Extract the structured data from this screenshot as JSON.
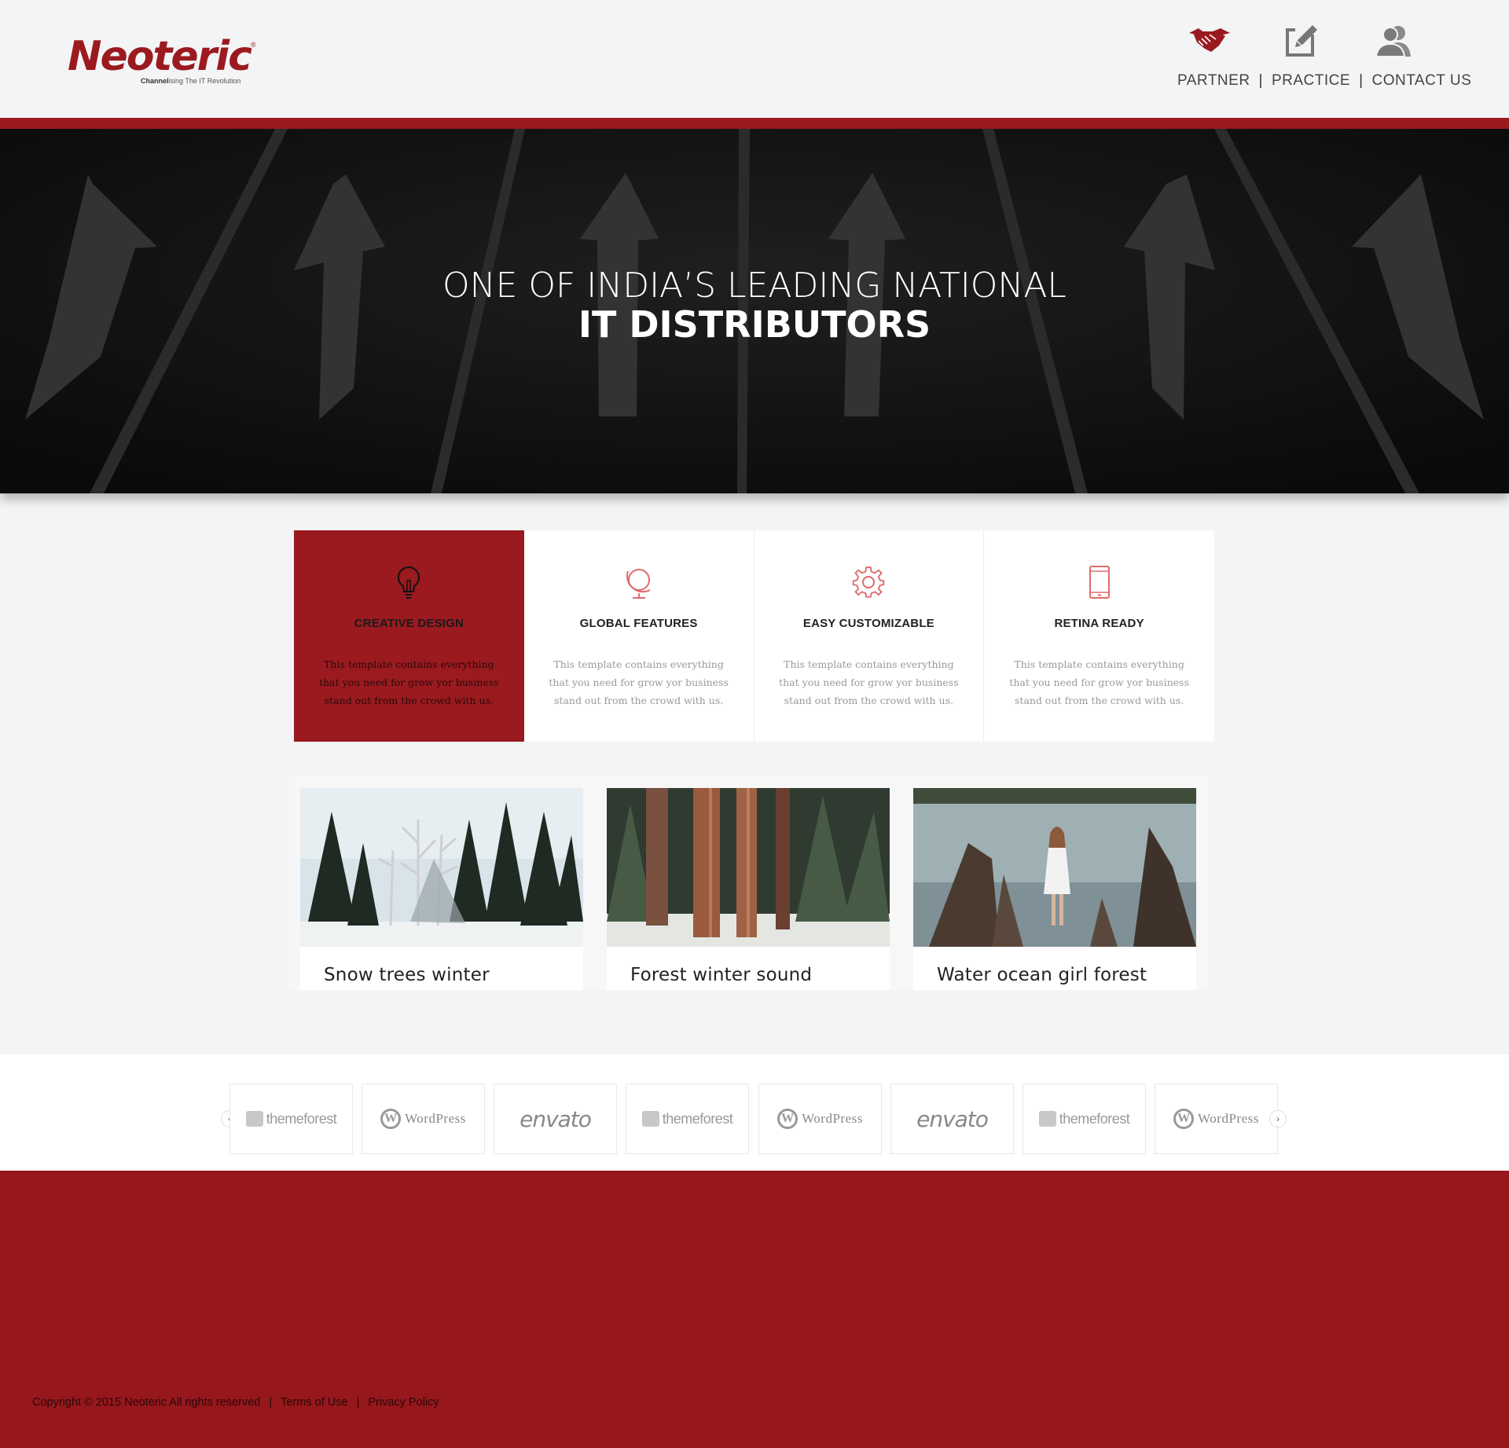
{
  "brand": {
    "name": "Neoteric",
    "registered_mark": "®",
    "tagline_bold": "Channel",
    "tagline_rest": "ising The IT Revolution",
    "color": "#9a1a1f"
  },
  "nav": {
    "icons": [
      "handshake-icon",
      "edit-icon",
      "user-group-icon"
    ],
    "items": [
      {
        "label": "PARTNER"
      },
      {
        "label": "PRACTICE"
      },
      {
        "label": "CONTACT US"
      }
    ],
    "separator": "|"
  },
  "hero": {
    "line1": "ONE OF INDIA’S LEADING NATIONAL",
    "line2": "IT DISTRIBUTORS"
  },
  "features": [
    {
      "icon": "lightbulb-icon",
      "title": "CREATIVE DESIGN",
      "desc": "This template contains everything that you need for grow yor business stand out from the crowd with us.",
      "active": true
    },
    {
      "icon": "globe-icon",
      "title": "GLOBAL FEATURES",
      "desc": "This template contains everything that you need for grow yor business stand out from the crowd with us.",
      "active": false
    },
    {
      "icon": "gear-icon",
      "title": "EASY CUSTOMIZABLE",
      "desc": "This template contains everything that you need for grow yor business stand out from the crowd with us.",
      "active": false
    },
    {
      "icon": "mobile-icon",
      "title": "RETINA READY",
      "desc": "This template contains everything that you need for grow yor business stand out from the crowd with us.",
      "active": false
    }
  ],
  "gallery": [
    {
      "title": "Snow trees winter"
    },
    {
      "title": "Forest winter sound"
    },
    {
      "title": "Water ocean girl forest"
    }
  ],
  "partner_logos": [
    "themeforest",
    "WordPress",
    "envato",
    "themeforest",
    "WordPress",
    "envato",
    "themeforest",
    "WordPress"
  ],
  "carousel": {
    "prev": "‹",
    "next": "›"
  },
  "footer": {
    "copyright": "Copyright © 2015 Neoteric All rights reserved",
    "terms": "Terms of Use",
    "privacy": "Privacy Policy",
    "separator": "|"
  },
  "colors": {
    "accent": "#9a1a1f",
    "footer_bg": "#96171c",
    "page_bg": "#f3f4f6"
  }
}
